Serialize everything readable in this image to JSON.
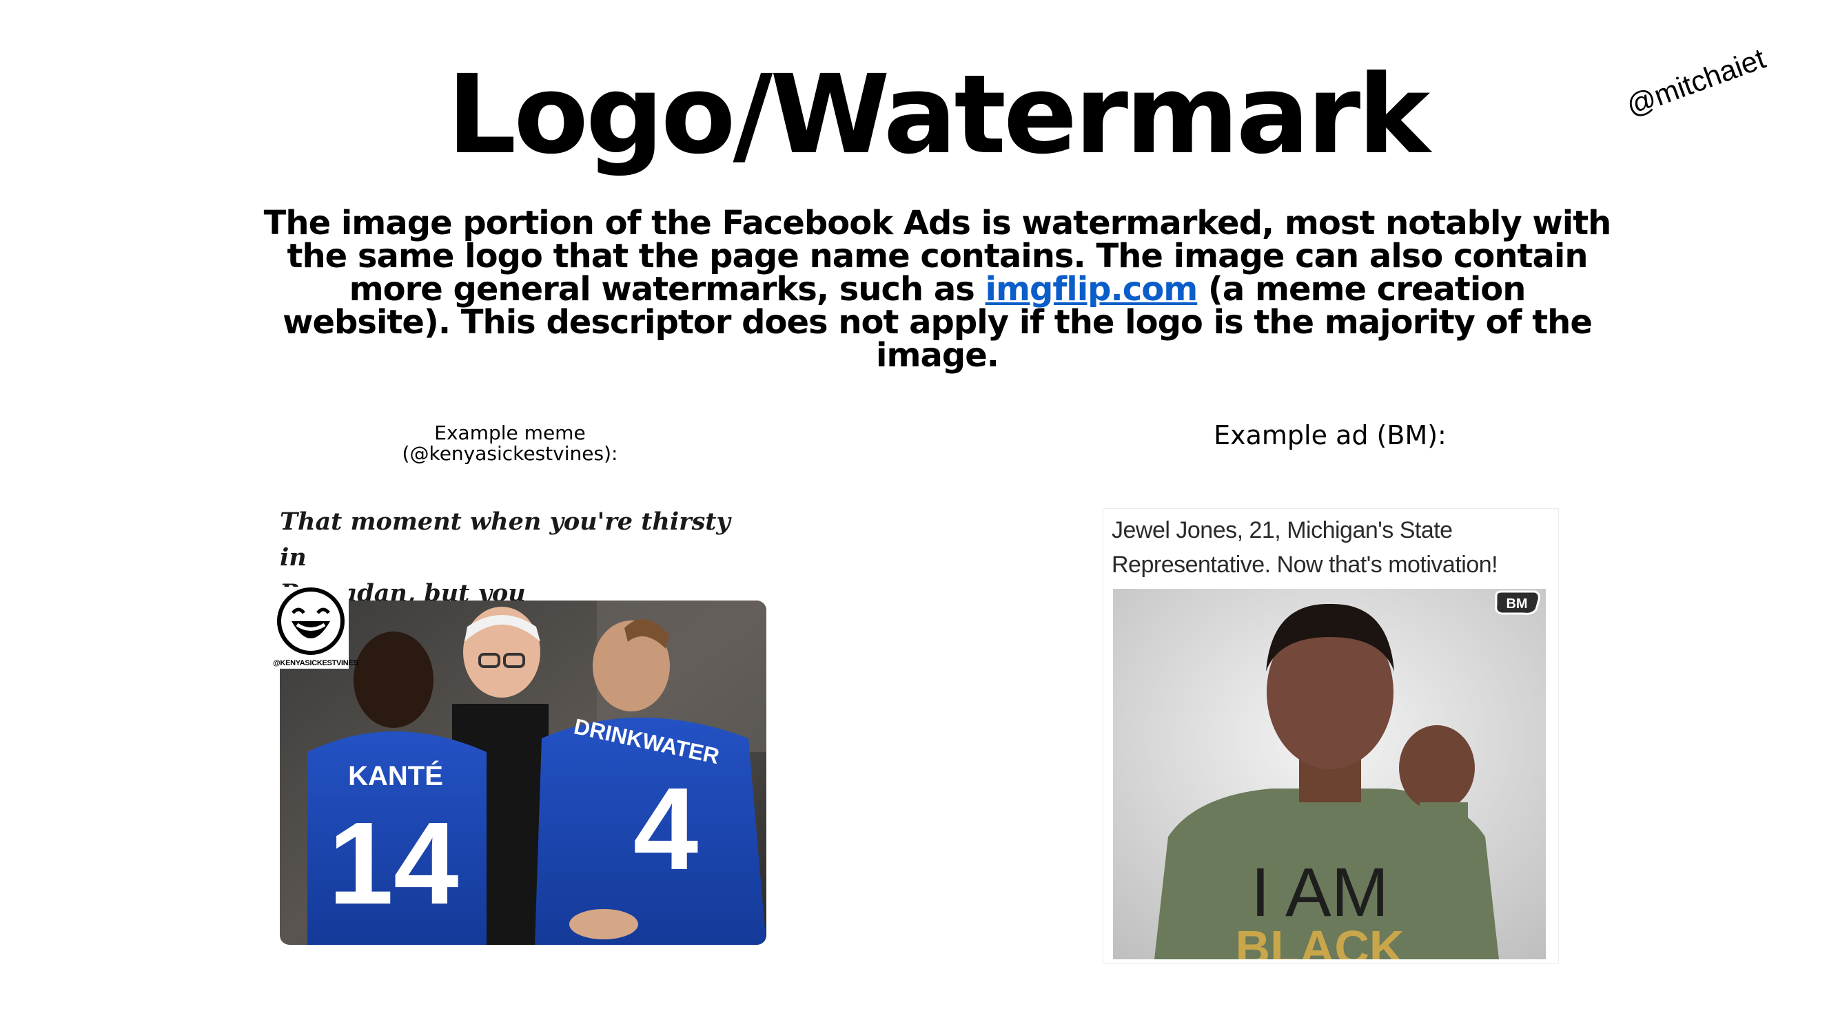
{
  "slide": {
    "title": "Logo/Watermark",
    "author_handle": "@mitchaiet",
    "description": {
      "before_link": "The image portion of the Facebook Ads is watermarked, most notably with the same logo that the page name contains. The image can also contain more general watermarks, such as ",
      "link_text": "imgflip.com",
      "after_link": " (a meme creation website). This descriptor does not apply if the logo is the majority of the image."
    },
    "link_color": "#0b5ec9"
  },
  "left_example": {
    "caption_line1": "Example meme",
    "caption_line2": "(@kenyasickestvines):",
    "meme_text_line1": "That moment when you're thirsty in",
    "meme_text_line2": "Ramadan, but you",
    "watermark_text": "@KENYASICKESTVINES",
    "jersey_left_name": "KANTÉ",
    "jersey_left_number": "14",
    "jersey_right_name": "DRINKWATER",
    "jersey_right_number": "4"
  },
  "right_example": {
    "caption": "Example ad (BM):",
    "ad_text_line1": "Jewel Jones, 21, Michigan's State",
    "ad_text_line2": "Representative. Now that's motivation!",
    "badge_text": "BM",
    "shirt_line1": "I AM",
    "shirt_line2": "BLACK"
  }
}
